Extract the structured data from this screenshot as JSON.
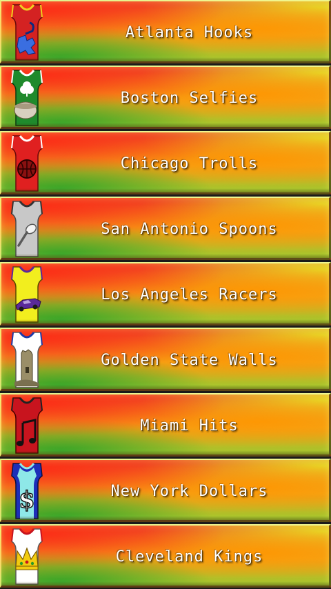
{
  "teams": [
    {
      "name": "Atlanta Hooks",
      "jersey_color": "#d42222",
      "trim_color": "#f0d020",
      "logo_icon": "hook-puzzle-icon"
    },
    {
      "name": "Boston Selfies",
      "jersey_color": "#1f8a2c",
      "trim_color": "#ffffff",
      "logo_icon": "shamrock-bowl-icon"
    },
    {
      "name": "Chicago Trolls",
      "jersey_color": "#e02020",
      "trim_color": "#ffffff",
      "logo_icon": "basketball-icon"
    },
    {
      "name": "San Antonio Spoons",
      "jersey_color": "#c8c8c8",
      "trim_color": "#333333",
      "logo_icon": "spoon-icon"
    },
    {
      "name": "Los Angeles Racers",
      "jersey_color": "#f2ee1e",
      "trim_color": "#5a2a9a",
      "logo_icon": "race-car-icon"
    },
    {
      "name": "Golden State Walls",
      "jersey_color": "#ffffff",
      "trim_color": "#1f3aa8",
      "logo_icon": "castle-wall-icon"
    },
    {
      "name": "Miami Hits",
      "jersey_color": "#c8141e",
      "trim_color": "#222222",
      "logo_icon": "music-note-icon"
    },
    {
      "name": "New York Dollars",
      "jersey_color": "#8ee8e8",
      "trim_color": "#1d2fb8",
      "logo_icon": "dollar-sign-icon"
    },
    {
      "name": "Cleveland Kings",
      "jersey_color": "#ffffff",
      "trim_color": "#c8141e",
      "logo_icon": "crown-icon"
    }
  ]
}
